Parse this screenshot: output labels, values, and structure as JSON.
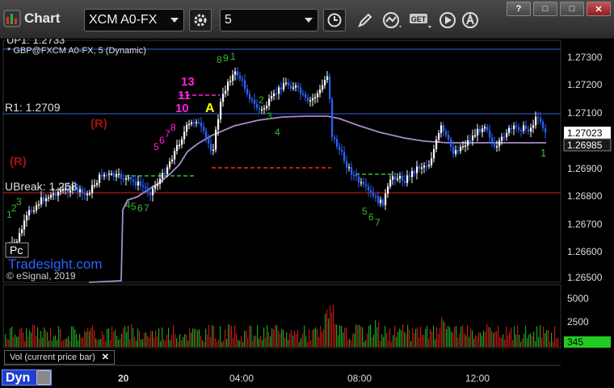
{
  "window": {
    "title": "Chart",
    "controls": [
      "?",
      "□",
      "□",
      "✕"
    ]
  },
  "toolbar": {
    "symbol": "XCM A0-FX",
    "interval": "5",
    "get_label": "GET"
  },
  "chart": {
    "study_label": "* GBP@FXCM A0-FX, 5 (Dynamic)",
    "copyright": "© eSignal, 2019",
    "watermark": "Tradesight.com",
    "pc_label": "Pc",
    "dyn_label": "Dyn"
  },
  "levels": {
    "up1_label": "UP1: 1.2733",
    "r1_label": "R1: 1.2709",
    "ubreak_label": "UBreak: 1.268",
    "r_marks": [
      "(R)",
      "(R)"
    ],
    "a_mark": "A"
  },
  "price_axis": {
    "ticks": [
      "1.27300",
      "1.27200",
      "1.27100",
      "1.27000",
      "1.26900",
      "1.26800",
      "1.26700",
      "1.26600",
      "1.26500"
    ],
    "last_price": "1.27023",
    "ma_price": "1.26985"
  },
  "volume_axis": {
    "ticks": [
      "5000",
      "2500"
    ],
    "last_volume": "345"
  },
  "volume_legend": {
    "label": "Vol (current price bar)",
    "close": "✕"
  },
  "time_axis": {
    "ticks": [
      "20",
      "04:00",
      "08:00",
      "12:00"
    ]
  },
  "td_marks": {
    "magenta": [
      "13",
      "11",
      "10"
    ],
    "green_right": "1"
  },
  "colors": {
    "up_bar": "#ffffff",
    "down_bar": "#2a63ff",
    "ma_line": "#a98bc9",
    "r_level": "#3a5fd6",
    "ubreak_level": "#cc2222",
    "td_green": "#2fbf2f",
    "td_magenta": "#ff22dd",
    "r_mark": "#a01010",
    "a_mark": "#ffff00",
    "vol_up": "#20a020",
    "vol_down": "#c01818",
    "last_price_bg": "#ffffff",
    "vol_badge_bg": "#22cc22"
  }
}
